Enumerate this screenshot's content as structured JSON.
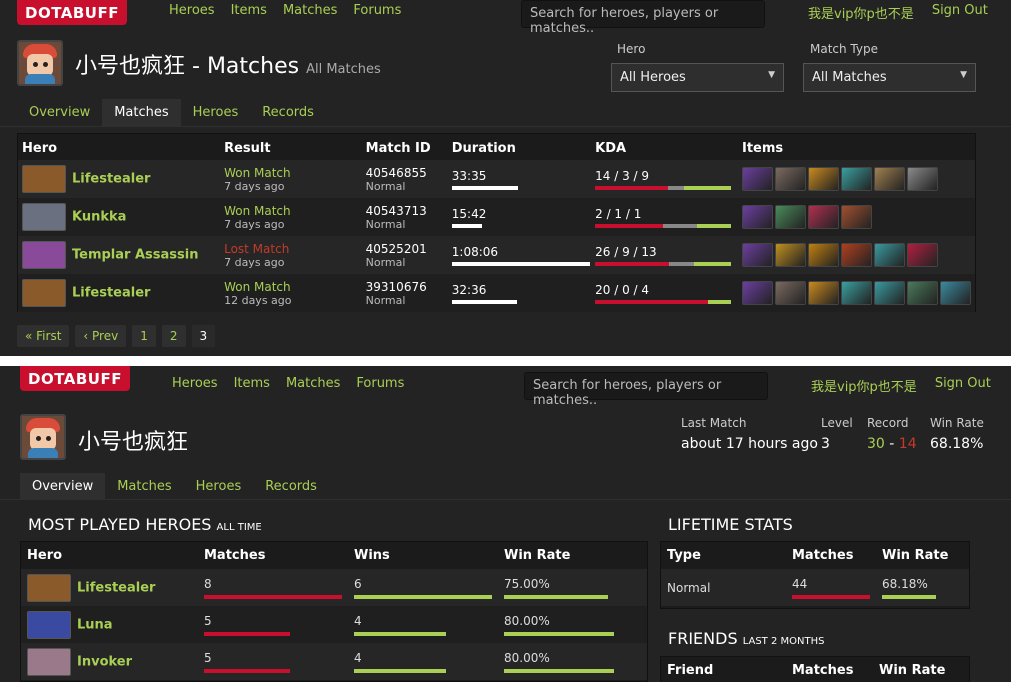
{
  "brand": "DOTABUFF",
  "nav": [
    "Heroes",
    "Items",
    "Matches",
    "Forums"
  ],
  "search_placeholder": "Search for heroes, players or matches..",
  "user": {
    "name": "我是vip你p也不是",
    "signout": "Sign Out"
  },
  "matches_page": {
    "player_name": "小号也疯狂",
    "title_suffix": "- Matches",
    "title_sub": "All Matches",
    "filters": {
      "hero_label": "Hero",
      "hero_value": "All Heroes",
      "type_label": "Match Type",
      "type_value": "All Matches"
    },
    "tabs": [
      "Overview",
      "Matches",
      "Heroes",
      "Records"
    ],
    "active_tab": "Matches",
    "columns": [
      "Hero",
      "Result",
      "Match ID",
      "Duration",
      "KDA",
      "Items"
    ],
    "rows": [
      {
        "hero": "Lifestealer",
        "hero_color": "#8a5a2a",
        "result": "Won Match",
        "win": true,
        "when": "7 days ago",
        "match_id": "40546855",
        "mode": "Normal",
        "duration": "33:35",
        "duration_frac": 0.48,
        "kda": "14 / 3 / 9",
        "k": 14,
        "d": 3,
        "a": 9,
        "items": [
          "#6b3fa0",
          "#7a6a60",
          "#c88a20",
          "#3aa0a0",
          "#a08050",
          "#8a8a8a"
        ]
      },
      {
        "hero": "Kunkka",
        "hero_color": "#6a7080",
        "result": "Won Match",
        "win": true,
        "when": "7 days ago",
        "match_id": "40543713",
        "mode": "Normal",
        "duration": "15:42",
        "duration_frac": 0.22,
        "kda": "2 / 1 / 1",
        "k": 2,
        "d": 1,
        "a": 1,
        "items": [
          "#6b3fa0",
          "#4a8a5a",
          "#b03050",
          "#a05030"
        ]
      },
      {
        "hero": "Templar Assassin",
        "hero_color": "#8a4a9a",
        "result": "Lost Match",
        "win": false,
        "when": "7 days ago",
        "match_id": "40525201",
        "mode": "Normal",
        "duration": "1:08:06",
        "duration_frac": 1.0,
        "kda": "26 / 9 / 13",
        "k": 26,
        "d": 9,
        "a": 13,
        "items": [
          "#6b3fa0",
          "#c09020",
          "#c08010",
          "#b04020",
          "#3a9aa0",
          "#b02040"
        ]
      },
      {
        "hero": "Lifestealer",
        "hero_color": "#8a5a2a",
        "result": "Won Match",
        "win": true,
        "when": "12 days ago",
        "match_id": "39310676",
        "mode": "Normal",
        "duration": "32:36",
        "duration_frac": 0.47,
        "kda": "20 / 0 / 4",
        "k": 20,
        "d": 0,
        "a": 4,
        "items": [
          "#6b3fa0",
          "#7a6a60",
          "#c88a20",
          "#3aa0a0",
          "#3a9aa0",
          "#4a7a5a",
          "#3a8aa0"
        ]
      }
    ],
    "pager": [
      "« First",
      "‹ Prev",
      "1",
      "2",
      "3"
    ],
    "pager_current": "3"
  },
  "overview_page": {
    "player_name": "小号也疯狂",
    "stats": {
      "last_match_label": "Last Match",
      "last_match": "about 17 hours ago",
      "level_label": "Level",
      "level": "3",
      "record_label": "Record",
      "record_w": "30",
      "record_l": "14",
      "winrate_label": "Win Rate",
      "winrate": "68.18%"
    },
    "tabs": [
      "Overview",
      "Matches",
      "Heroes",
      "Records"
    ],
    "active_tab": "Overview",
    "most_played": {
      "title": "MOST PLAYED HEROES",
      "title_sub": "ALL TIME",
      "columns": [
        "Hero",
        "Matches",
        "Wins",
        "Win Rate"
      ],
      "rows": [
        {
          "hero": "Lifestealer",
          "hero_color": "#8a5a2a",
          "matches": "8",
          "matches_frac": 1.0,
          "wins": "6",
          "wins_frac": 1.0,
          "winrate": "75.00%",
          "winrate_frac": 0.75
        },
        {
          "hero": "Luna",
          "hero_color": "#3a4aa0",
          "matches": "5",
          "matches_frac": 0.62,
          "wins": "4",
          "wins_frac": 0.67,
          "winrate": "80.00%",
          "winrate_frac": 0.8
        },
        {
          "hero": "Invoker",
          "hero_color": "#9a7a8a",
          "matches": "5",
          "matches_frac": 0.62,
          "wins": "4",
          "wins_frac": 0.67,
          "winrate": "80.00%",
          "winrate_frac": 0.8
        }
      ]
    },
    "lifetime": {
      "title": "LIFETIME STATS",
      "columns": [
        "Type",
        "Matches",
        "Win Rate"
      ],
      "row": {
        "type": "Normal",
        "matches": "44",
        "winrate": "68.18%",
        "winrate_frac": 0.68
      }
    },
    "friends": {
      "title": "FRIENDS",
      "title_sub": "LAST 2 MONTHS",
      "columns": [
        "Friend",
        "Matches",
        "Win Rate"
      ]
    }
  }
}
